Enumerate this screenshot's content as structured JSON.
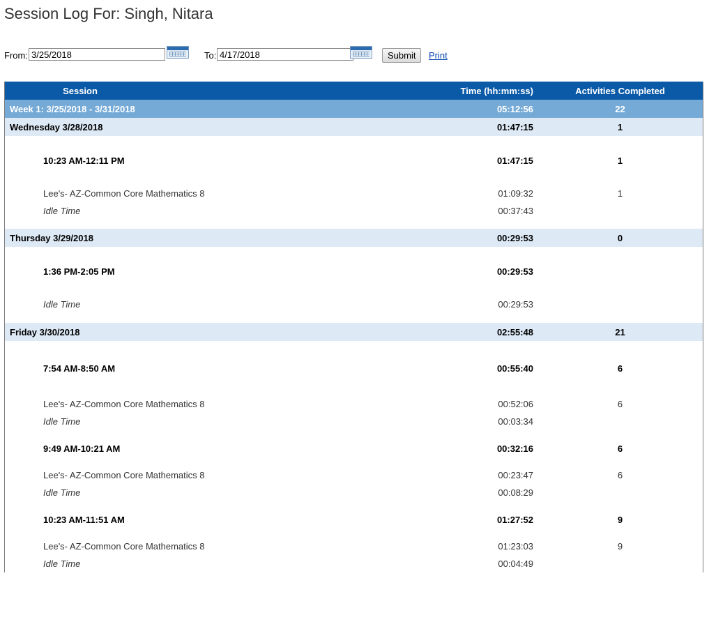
{
  "page": {
    "title": "Session Log For: Singh, Nitara"
  },
  "filter": {
    "from_label": "From:",
    "from_value": "3/25/2018",
    "to_label": "To:",
    "to_value": "4/17/2018",
    "submit_label": "Submit",
    "print_label": "Print",
    "calendar_icon": "calendar-icon"
  },
  "table": {
    "headers": {
      "session": "Session",
      "time": "Time (hh:mm:ss)",
      "activities": "Activities Completed"
    },
    "week": {
      "label": "Week 1: 3/25/2018 - 3/31/2018",
      "time": "05:12:56",
      "activities": "22"
    },
    "days": [
      {
        "label": "Wednesday 3/28/2018",
        "time": "01:47:15",
        "activities": "1",
        "sessions": [
          {
            "label": "10:23 AM-12:11 PM",
            "time": "01:47:15",
            "activities": "1",
            "course": {
              "label": "Lee's- AZ-Common Core Mathematics 8",
              "time": "01:09:32",
              "activities": "1"
            },
            "idle": {
              "label": "Idle Time",
              "time": "00:37:43"
            }
          }
        ]
      },
      {
        "label": "Thursday 3/29/2018",
        "time": "00:29:53",
        "activities": "0",
        "sessions": [
          {
            "label": "1:36 PM-2:05 PM",
            "time": "00:29:53",
            "activities": "",
            "idle": {
              "label": "Idle Time",
              "time": "00:29:53"
            }
          }
        ]
      },
      {
        "label": "Friday 3/30/2018",
        "time": "02:55:48",
        "activities": "21",
        "sessions": [
          {
            "label": "7:54 AM-8:50 AM",
            "time": "00:55:40",
            "activities": "6",
            "course": {
              "label": "Lee's- AZ-Common Core Mathematics 8",
              "time": "00:52:06",
              "activities": "6"
            },
            "idle": {
              "label": "Idle Time",
              "time": "00:03:34"
            }
          },
          {
            "label": "9:49 AM-10:21 AM",
            "time": "00:32:16",
            "activities": "6",
            "course": {
              "label": "Lee's- AZ-Common Core Mathematics 8",
              "time": "00:23:47",
              "activities": "6"
            },
            "idle": {
              "label": "Idle Time",
              "time": "00:08:29"
            }
          },
          {
            "label": "10:23 AM-11:51 AM",
            "time": "01:27:52",
            "activities": "9",
            "course": {
              "label": "Lee's- AZ-Common Core Mathematics 8",
              "time": "01:23:03",
              "activities": "9"
            },
            "idle": {
              "label": "Idle Time",
              "time": "00:04:49"
            }
          }
        ]
      }
    ]
  }
}
